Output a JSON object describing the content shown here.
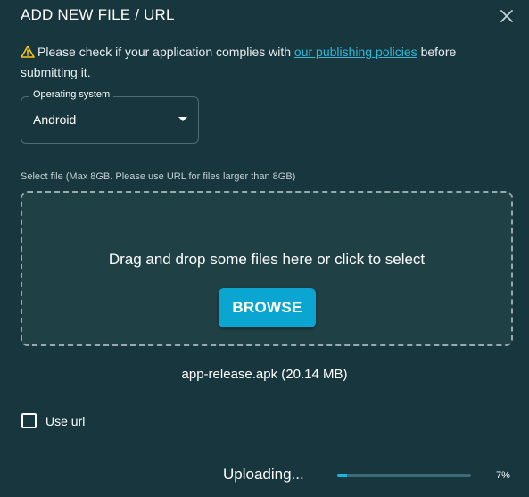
{
  "dialog": {
    "title": "ADD NEW FILE / URL",
    "close_icon": "close-icon"
  },
  "warning": {
    "icon": "warning-icon",
    "text_before": "Please check if your application complies with ",
    "link_text": "our publishing policies",
    "text_after": " before submitting it."
  },
  "os_select": {
    "label": "Operating system",
    "value": "Android"
  },
  "file_select": {
    "label": "Select file (Max 8GB. Please use URL for files larger than 8GB)",
    "dropzone_text": "Drag and drop some files here or click to select",
    "browse_label": "BROWSE"
  },
  "file_info": "app-release.apk (20.14 MB)",
  "use_url": {
    "label": "Use url",
    "checked": false
  },
  "upload": {
    "status_text": "Uploading...",
    "progress_percent": 7,
    "percent_label": "7%"
  },
  "colors": {
    "background": "#17363d",
    "accent": "#0aa6d1",
    "link": "#31b8d6",
    "warning": "#f5c518"
  }
}
